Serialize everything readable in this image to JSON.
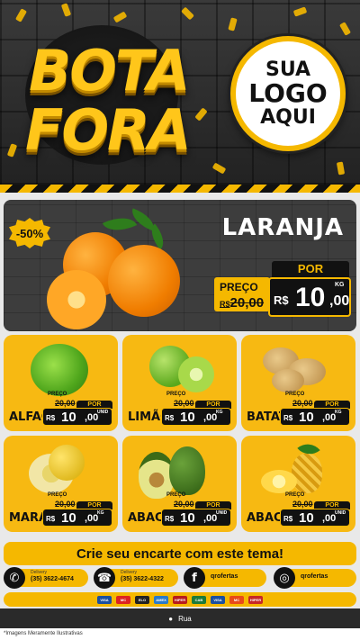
{
  "header": {
    "title_line1": "BOTA",
    "title_line2": "FORA",
    "logo_line1": "SUA",
    "logo_line2": "LOGO",
    "logo_line3": "AQUI"
  },
  "hero": {
    "badge": "-50%",
    "name": "LARANJA",
    "por_label": "POR",
    "old_label": "PREÇO",
    "old_price": "20,00",
    "old_price_prefix": "R$",
    "currency": "R$",
    "price_int": "10",
    "price_dec": ",00",
    "unit": "KG"
  },
  "products": [
    {
      "name": "ALFACE",
      "old_label": "PREÇO",
      "old_price": "20,00",
      "por_label": "POR",
      "currency": "R$",
      "price_int": "10",
      "price_dec": ",00",
      "unit": "UNID"
    },
    {
      "name": "LIMÃO",
      "old_label": "PREÇO",
      "old_price": "20,00",
      "por_label": "POR",
      "currency": "R$",
      "price_int": "10",
      "price_dec": ",00",
      "unit": "KG"
    },
    {
      "name": "BATATA",
      "old_label": "PREÇO",
      "old_price": "20,00",
      "por_label": "POR",
      "currency": "R$",
      "price_int": "10",
      "price_dec": ",00",
      "unit": "KG"
    },
    {
      "name": "MARACUJÁ",
      "old_label": "PREÇO",
      "old_price": "20,00",
      "por_label": "POR",
      "currency": "R$",
      "price_int": "10",
      "price_dec": ",00",
      "unit": "KG"
    },
    {
      "name": "ABACATE",
      "old_label": "PREÇO",
      "old_price": "20,00",
      "por_label": "POR",
      "currency": "R$",
      "price_int": "10",
      "price_dec": ",00",
      "unit": "UNID"
    },
    {
      "name": "ABACAXI",
      "old_label": "PREÇO",
      "old_price": "20,00",
      "por_label": "POR",
      "currency": "R$",
      "price_int": "10",
      "price_dec": ",00",
      "unit": "UNID"
    }
  ],
  "cta": "Crie seu encarte com este tema!",
  "contacts": {
    "whatsapp": {
      "label": "Delivery",
      "value": "(35) 3622-4674"
    },
    "phone": {
      "label": "Delivery",
      "value": "(35) 3622-4322"
    },
    "facebook": {
      "value": "qrofertas"
    },
    "instagram": {
      "value": "qrofertas"
    }
  },
  "payments": [
    "VISA",
    "MC",
    "ELO",
    "AMEX",
    "HIPER",
    "CAB",
    "VISA",
    "MC",
    "HIPER"
  ],
  "address": "Rua",
  "footnote": "*Imagens Meramente Ilustrativas",
  "colors": {
    "accent": "#f5b800",
    "dark": "#2a2a2a",
    "text": "#111111"
  }
}
